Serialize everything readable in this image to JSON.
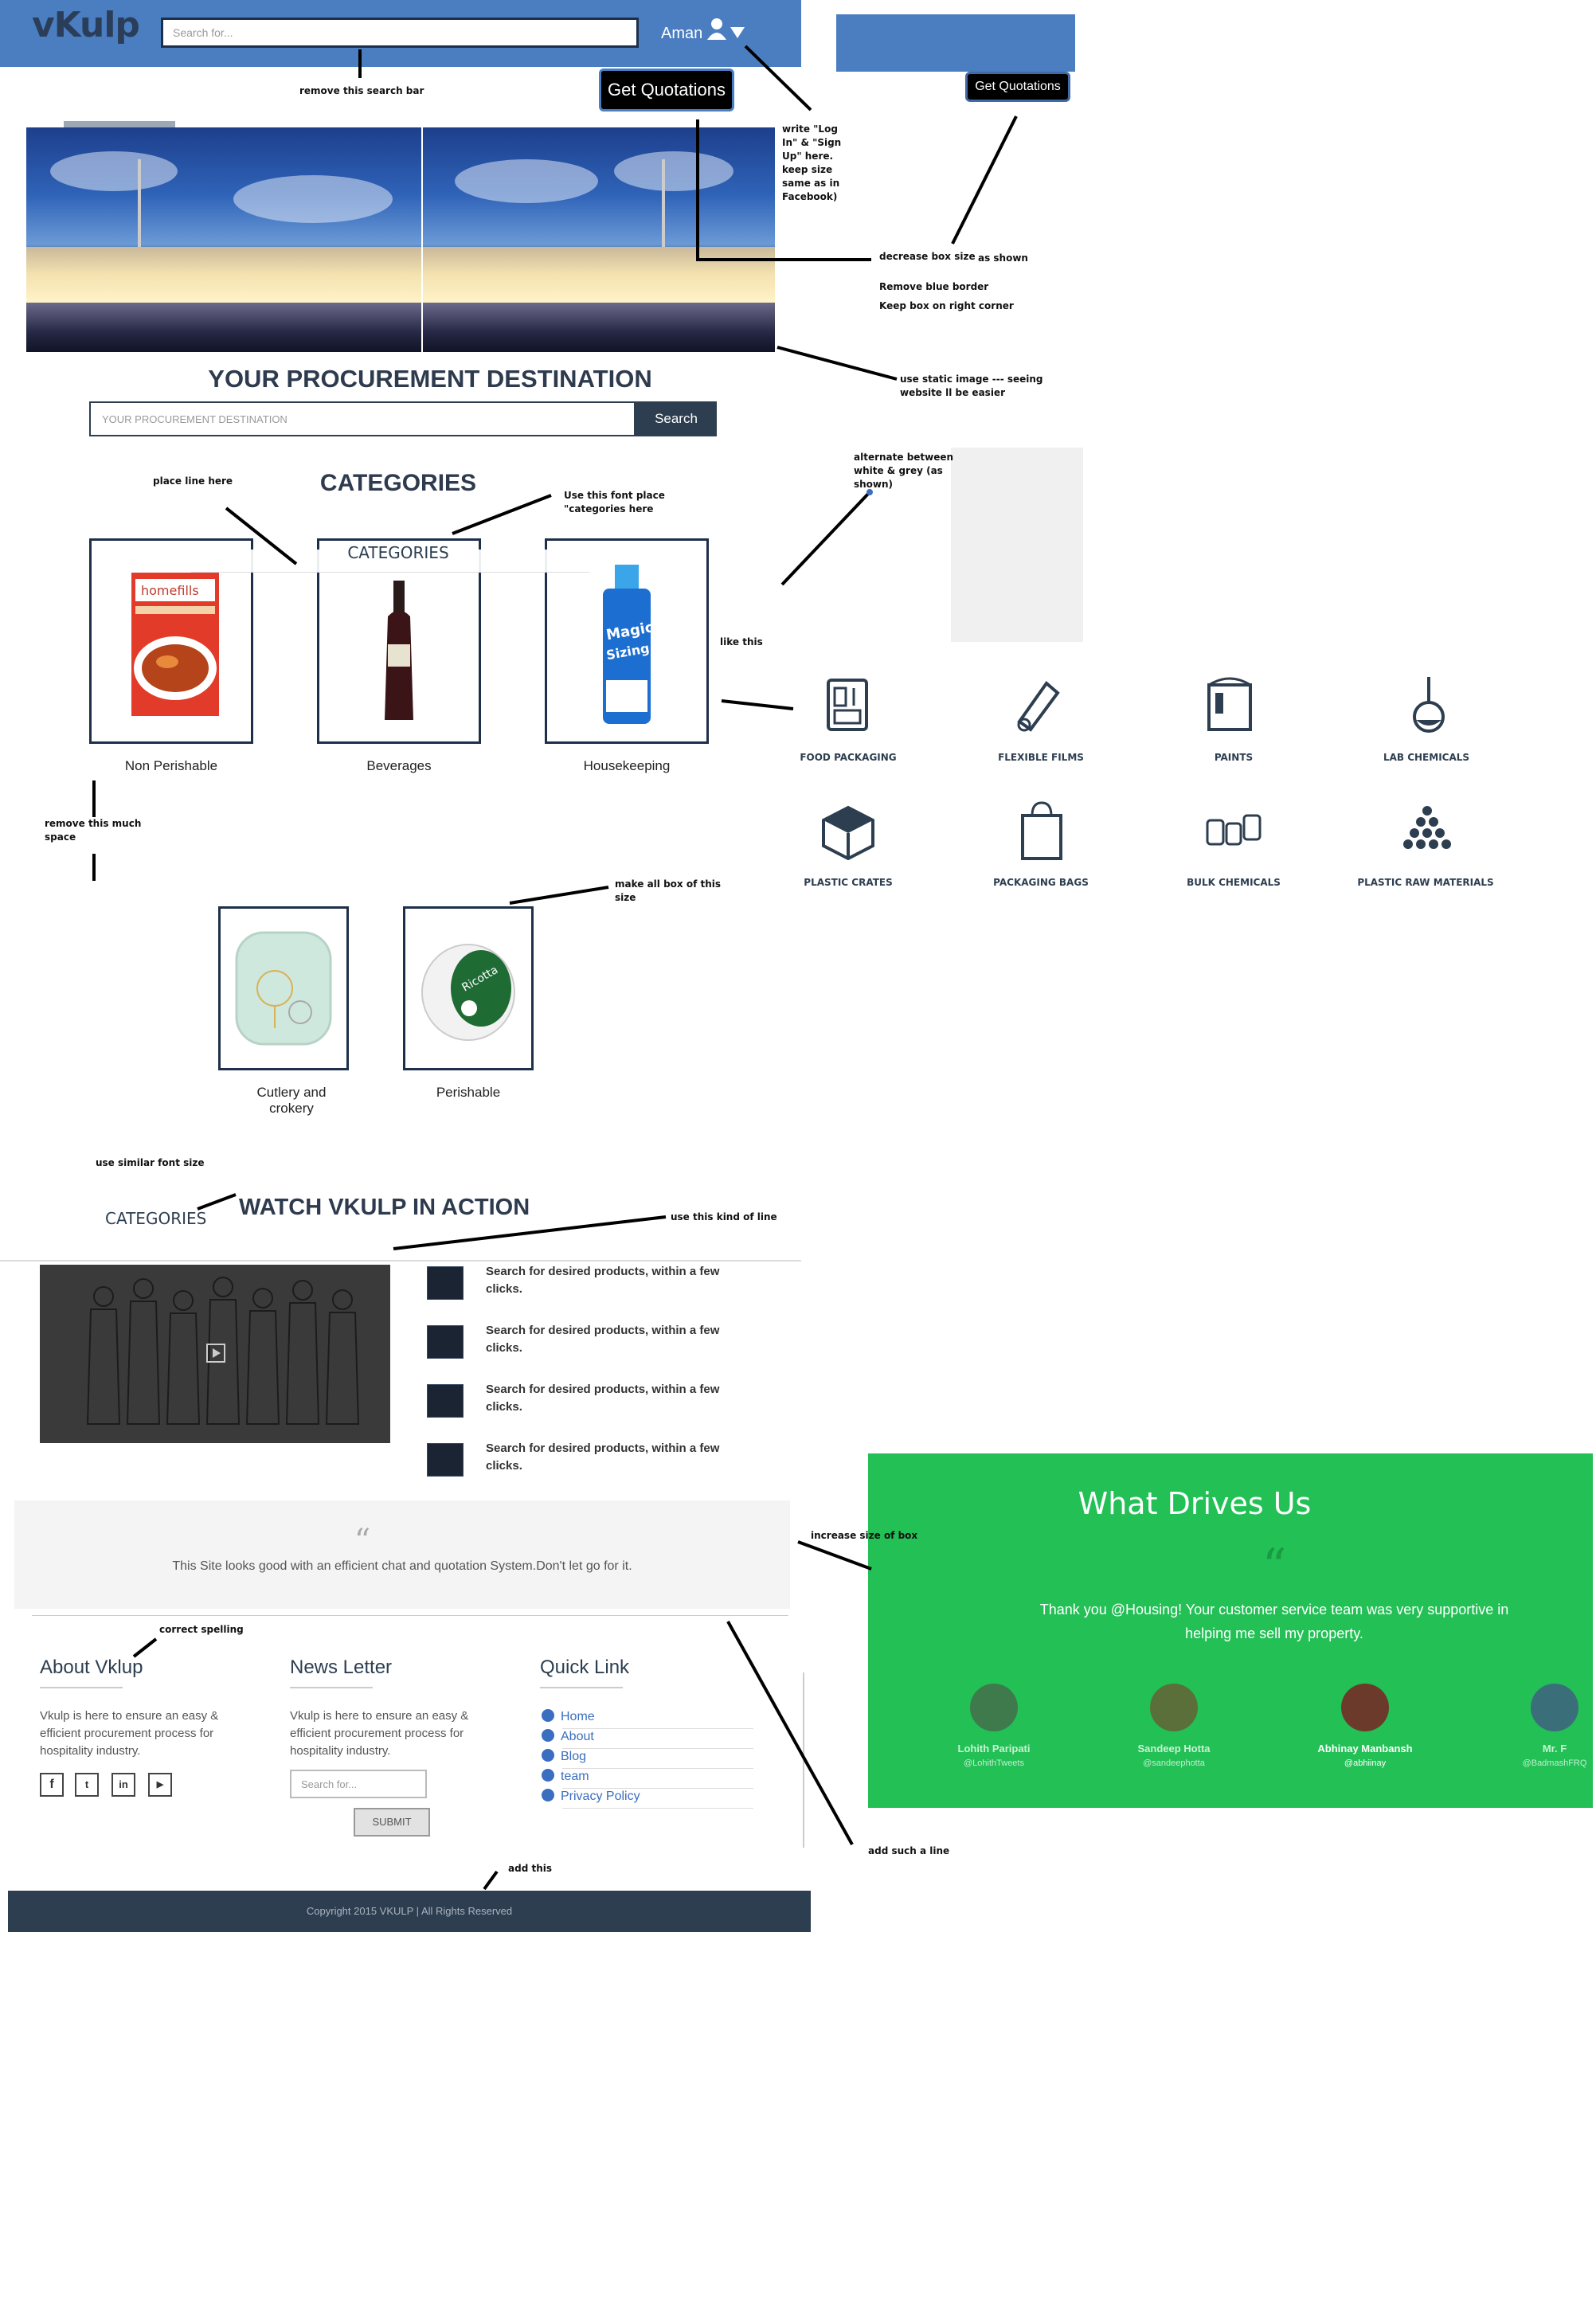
{
  "header": {
    "logo": "vKulp",
    "search_placeholder": "Search for...",
    "user_name": "Aman",
    "get_quotations": "Get Quotations"
  },
  "hero": {
    "title": "YOUR PROCUREMENT DESTINATION",
    "search_placeholder": "YOUR PROCUREMENT DESTINATION",
    "search_button": "Search"
  },
  "categories": {
    "title": "CATEGORIES",
    "sample_title": "CATEGORIES",
    "items": [
      "Non Perishable",
      "Beverages",
      "Housekeeping",
      "Cutlery and crokery",
      "Perishable"
    ]
  },
  "reference_categories": [
    "FOOD PACKAGING",
    "FLEXIBLE FILMS",
    "PAINTS",
    "LAB CHEMICALS",
    "PLASTIC CRATES",
    "PACKAGING BAGS",
    "BULK CHEMICALS",
    "PLASTIC RAW MATERIALS"
  ],
  "watch": {
    "small_label": "CATEGORIES",
    "title": "WATCH VKULP IN ACTION",
    "features": [
      "Search for desired products, within a few clicks.",
      "Search for desired products, within a few clicks.",
      "Search for desired products, within a few clicks.",
      "Search for desired products, within a few clicks."
    ]
  },
  "testimonial": {
    "quote_mark": "“",
    "text": "This Site looks good with an efficient chat and quotation System.Don't let go for it."
  },
  "drives": {
    "title": "What Drives Us",
    "quote_mark": "“",
    "text": "Thank you @Housing! Your customer service team was very supportive in helping me sell my property.",
    "people": [
      {
        "name": "Lohith Paripati",
        "handle": "@LohithTweets"
      },
      {
        "name": "Sandeep Hotta",
        "handle": "@sandeephotta"
      },
      {
        "name": "Abhinay Manbansh",
        "handle": "@abhiinay"
      },
      {
        "name": "Mr. F",
        "handle": "@BadmashFRQ"
      }
    ]
  },
  "footer": {
    "about_title": "About Vklup",
    "about_text": "Vkulp is here to ensure an easy & efficient procurement process for hospitality industry.",
    "news_title": "News Letter",
    "news_text": "Vkulp is here to ensure an easy & efficient procurement process for hospitality industry.",
    "news_placeholder": "Search for...",
    "submit": "SUBMIT",
    "quick_title": "Quick Link",
    "links": [
      "Home",
      "About",
      "Blog",
      "team",
      "Privacy Policy"
    ],
    "copyright": "Copyright 2015 VKULP | All Rights Reserved"
  },
  "notes": {
    "remove_search": "remove this search bar",
    "login": "write \"Log In\" & \"Sign Up\" here. keep size same as in Facebook)",
    "decrease_box": "decrease box size",
    "as_shown": "as shown",
    "remove_border": "Remove blue border",
    "keep_corner": "Keep box on right corner",
    "static_image": "use static image --- seeing website ll be easier",
    "alternate": "alternate between white & grey (as shown)",
    "place_line": "place line here",
    "use_font": "Use this font place \"categories here",
    "like_this": "like this",
    "remove_space": "remove this much space",
    "box_size": "make all box of this size",
    "similar_font": "use similar font size",
    "kind_of_line": "use this kind of line",
    "increase_box": "increase size of box",
    "correct_spelling": "correct spelling",
    "add_this": "add this",
    "add_line": "add such a line"
  }
}
